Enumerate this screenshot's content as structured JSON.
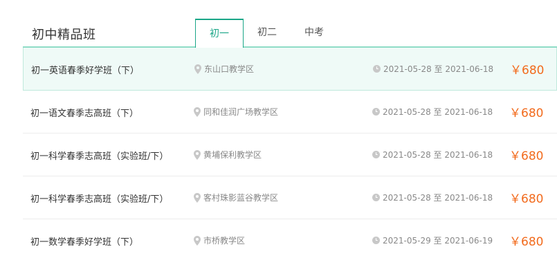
{
  "header": {
    "title": "初中精品班",
    "tabs": [
      {
        "label": "初一",
        "active": true
      },
      {
        "label": "初二",
        "active": false
      },
      {
        "label": "中考",
        "active": false
      }
    ]
  },
  "courses": [
    {
      "name": "初一英语春季好学班（下）",
      "location": "东山口教学区",
      "date": "2021-05-28 至 2021-06-18",
      "price": "￥680"
    },
    {
      "name": "初一语文春季志高班（下）",
      "location": "同和佳润广场教学区",
      "date": "2021-05-28 至 2021-06-18",
      "price": "￥680"
    },
    {
      "name": "初一科学春季志高班（实验班/下）",
      "location": "黄埔保利教学区",
      "date": "2021-05-28 至 2021-06-18",
      "price": "￥680"
    },
    {
      "name": "初一科学春季志高班（实验班/下）",
      "location": "客村珠影蓝谷教学区",
      "date": "2021-05-28 至 2021-06-18",
      "price": "￥680"
    },
    {
      "name": "初一数学春季好学班（下）",
      "location": "市桥教学区",
      "date": "2021-05-29 至 2021-06-19",
      "price": "￥680"
    }
  ],
  "colors": {
    "accent": "#1aa687",
    "price": "#f26b1d",
    "active_row_bg": "#effaf7"
  }
}
